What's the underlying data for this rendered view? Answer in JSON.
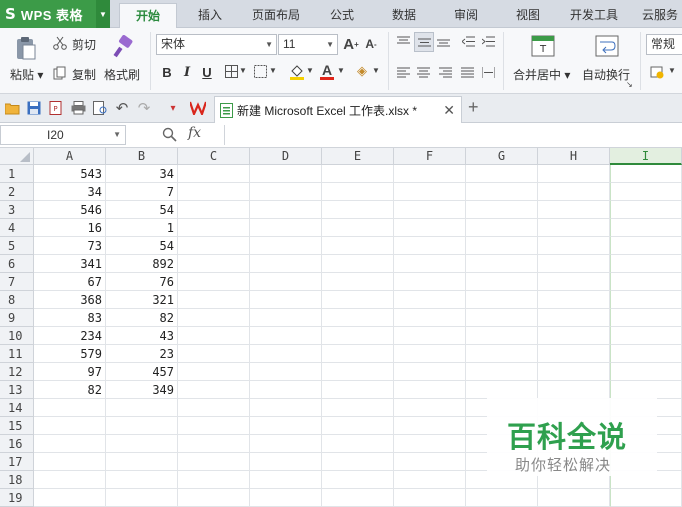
{
  "app": {
    "name": "WPS 表格",
    "logo": "S"
  },
  "tabs": [
    "开始",
    "插入",
    "页面布局",
    "公式",
    "数据",
    "审阅",
    "视图",
    "开发工具",
    "云服务"
  ],
  "active_tab_index": 0,
  "ribbon": {
    "paste": "粘贴",
    "cut": "剪切",
    "copy": "复制",
    "format_painter": "格式刷",
    "font_name": "宋体",
    "font_size": "11",
    "bold": "B",
    "italic": "I",
    "underline": "U",
    "font_color_letter": "A",
    "merge_center": "合并居中",
    "wrap_text": "自动换行",
    "number_format": "常规"
  },
  "document": {
    "title": "新建 Microsoft Excel 工作表.xlsx *"
  },
  "formula_bar": {
    "name_box": "I20",
    "fx": "fx",
    "value": ""
  },
  "columns": [
    "A",
    "B",
    "C",
    "D",
    "E",
    "F",
    "G",
    "H",
    "I"
  ],
  "selected_column": "I",
  "rows": [
    "1",
    "2",
    "3",
    "4",
    "5",
    "6",
    "7",
    "8",
    "9",
    "10",
    "11",
    "12",
    "13",
    "14",
    "15",
    "16",
    "17",
    "18",
    "19"
  ],
  "cells": {
    "A": [
      "543",
      "34",
      "546",
      "16",
      "73",
      "341",
      "67",
      "368",
      "83",
      "234",
      "579",
      "97",
      "82"
    ],
    "B": [
      "34",
      "7",
      "54",
      "1",
      "54",
      "892",
      "76",
      "321",
      "82",
      "43",
      "23",
      "457",
      "349"
    ]
  },
  "watermark": {
    "title": "百科全说",
    "subtitle": "助你轻松解决"
  },
  "colors": {
    "accent": "#2f8a3b",
    "wps_green": "#3c9b48"
  }
}
